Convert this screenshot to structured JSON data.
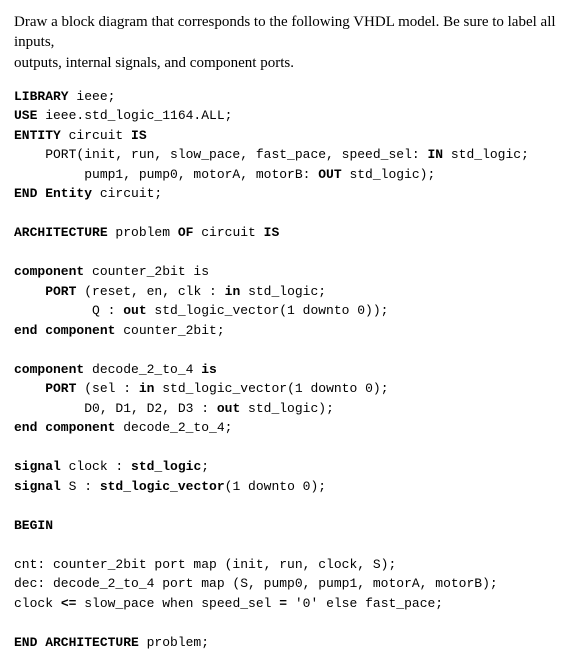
{
  "intro": {
    "line1": "Draw a block diagram that corresponds to the following VHDL model. Be sure to label all inputs,",
    "line2": "outputs, internal signals, and component ports."
  },
  "code": {
    "l1a": "LIBRARY",
    "l1b": " ieee;",
    "l2a": "USE",
    "l2b": " ieee.std_logic_1164.ALL;",
    "l3a": "ENTITY",
    "l3b": " circuit ",
    "l3c": "IS",
    "l4a": "    PORT(init, run, slow_pace, fast_pace, speed_sel: ",
    "l4b": "IN",
    "l4c": " std_logic;",
    "l5a": "         pump1, pump0, motorA, motorB: ",
    "l5b": "OUT",
    "l5c": " std_logic);",
    "l6a": "END Entity",
    "l6b": " circuit;",
    "l8a": "ARCHITECTURE",
    "l8b": " problem ",
    "l8c": "OF",
    "l8d": " circuit ",
    "l8e": "IS",
    "l10a": "component",
    "l10b": " counter_2bit is",
    "l11a": "    PORT",
    "l11b": " (reset, en, clk : ",
    "l11c": "in",
    "l11d": " std_logic;",
    "l12a": "          Q : ",
    "l12b": "out",
    "l12c": " std_logic_vector(1 downto 0));",
    "l13a": "end component",
    "l13b": " counter_2bit;",
    "l15a": "component",
    "l15b": " decode_2_to_4 ",
    "l15c": "is",
    "l16a": "    PORT",
    "l16b": " (sel : ",
    "l16c": "in",
    "l16d": " std_logic_vector(1 downto 0);",
    "l17a": "         D0, D1, D2, D3 : ",
    "l17b": "out",
    "l17c": " std_logic);",
    "l18a": "end component",
    "l18b": " decode_2_to_4;",
    "l20a": "signal",
    "l20b": " clock : ",
    "l20c": "std_logic",
    "l20d": ";",
    "l21a": "signal",
    "l21b": " S : ",
    "l21c": "std_logic_vector",
    "l21d": "(1 downto 0);",
    "l23a": "BEGIN",
    "l25": "cnt: counter_2bit port map (init, run, clock, S);",
    "l26": "dec: decode_2_to_4 port map (S, pump0, pump1, motorA, motorB);",
    "l27a": "clock ",
    "l27b": "<=",
    "l27c": " slow_pace when speed_sel ",
    "l27d": "=",
    "l27e": " '0' else fast_pace;",
    "l29a": "END ARCHITECTURE",
    "l29b": " problem;"
  }
}
